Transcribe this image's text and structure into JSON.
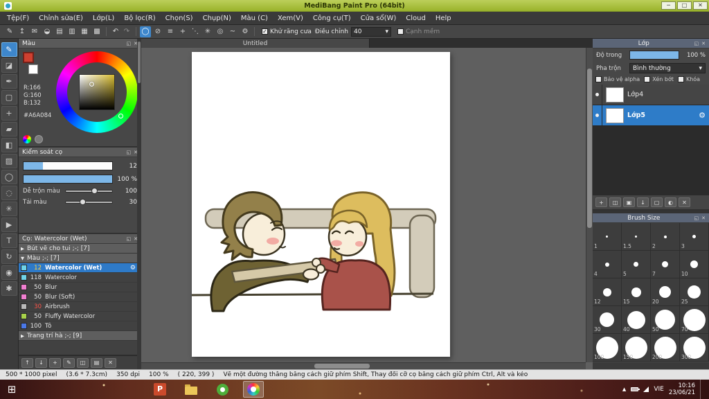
{
  "window": {
    "title": "MediBang Paint Pro (64bit)",
    "controls": [
      "─",
      "□",
      "✕"
    ]
  },
  "ui": {
    "detach_icon": "◱",
    "close_icon": "✕",
    "arrow_down": "▾",
    "gear": "⚙",
    "check": "✓"
  },
  "menubar": {
    "items": [
      "Tệp(F)",
      "Chỉnh sửa(E)",
      "Lớp(L)",
      "Bộ lọc(R)",
      "Chọn(S)",
      "Chụp(N)",
      "Màu (C)",
      "Xem(V)",
      "Công cụ(T)",
      "Cửa sổ(W)",
      "Cloud",
      "Help"
    ]
  },
  "toolbar": {
    "file_icons": [
      {
        "name": "brush-edit-icon",
        "glyph": "✎"
      },
      {
        "name": "upload-icon",
        "glyph": "↥"
      },
      {
        "name": "comment-icon",
        "glyph": "✉"
      },
      {
        "name": "palette-icon",
        "glyph": "◒"
      },
      {
        "name": "document-icon",
        "glyph": "▤"
      },
      {
        "name": "panel-icon",
        "glyph": "▥"
      },
      {
        "name": "pixel-grid-icon",
        "glyph": "▦"
      },
      {
        "name": "grid-icon",
        "glyph": "▩"
      }
    ],
    "undo_icon": "↶",
    "redo_icon": "↷",
    "snap_icons": [
      {
        "name": "brush-cursor-icon",
        "glyph": "◯",
        "selected": true
      },
      {
        "name": "snap-off-icon",
        "glyph": "⊘"
      },
      {
        "name": "snap-parallel-icon",
        "glyph": "≡"
      },
      {
        "name": "snap-cross-icon",
        "glyph": "+"
      },
      {
        "name": "snap-vanishing-icon",
        "glyph": "⋱"
      },
      {
        "name": "snap-radial-icon",
        "glyph": "✳"
      },
      {
        "name": "snap-ellipse-icon",
        "glyph": "◎"
      },
      {
        "name": "snap-curve-icon",
        "glyph": "~"
      },
      {
        "name": "snap-settings-icon",
        "glyph": "⚙"
      }
    ],
    "antialias_label": "Khử răng cưa",
    "adjust_label": "Điều chỉnh",
    "adjust_value": "40",
    "soft_edge_label": "Cạnh mềm"
  },
  "tools": {
    "items": [
      {
        "name": "brush-tool",
        "glyph": "✎",
        "selected": true
      },
      {
        "name": "eraser-tool",
        "glyph": "◪"
      },
      {
        "name": "pen-tool",
        "glyph": "✒"
      },
      {
        "name": "select-tool",
        "glyph": "▢"
      },
      {
        "name": "move-tool",
        "glyph": "+"
      },
      {
        "name": "fill-tool",
        "glyph": "▰"
      },
      {
        "name": "bucket-tool",
        "glyph": "◧"
      },
      {
        "name": "gradient-tool",
        "glyph": "▨"
      },
      {
        "name": "ellipse-select-tool",
        "glyph": "◯"
      },
      {
        "name": "lasso-tool",
        "glyph": "◌"
      },
      {
        "name": "magic-wand-tool",
        "glyph": "✳"
      },
      {
        "name": "operation-tool",
        "glyph": "▶"
      },
      {
        "name": "text-tool",
        "glyph": "T"
      },
      {
        "name": "rotate-tool",
        "glyph": "↻"
      },
      {
        "name": "eyedropper-tool",
        "glyph": "◉"
      },
      {
        "name": "hand-tool",
        "glyph": "✱"
      }
    ]
  },
  "color_panel": {
    "title": "Màu",
    "rgb_r": "R:166",
    "rgb_g": "G:160",
    "rgb_b": "B:132",
    "hex": "#A6A084",
    "foreground_color": "#cf4030",
    "background_color": "#ffffff",
    "square_hue": "#d8bc30"
  },
  "brush_control": {
    "title": "Kiểm soát cọ",
    "size_value": "12",
    "opacity_value": "100 %",
    "mix_label": "Dễ trộn màu",
    "mix_value": "100",
    "load_label": "Tải màu",
    "load_value": "30"
  },
  "brush_panel": {
    "title": "Cọ: Watercolor (Wet)",
    "groups": [
      {
        "label": "Bút vẽ cho tui ;-; [7]",
        "arrow": "▶"
      },
      {
        "label": "Màu ;-; [7]",
        "arrow": "▼"
      }
    ],
    "brushes": [
      {
        "size": "12",
        "name": "Watercolor (Wet)",
        "swatch": "#6fd3e8",
        "selected": true,
        "size_color": "#ffcf3f"
      },
      {
        "size": "118",
        "name": "Watercolor",
        "swatch": "#6fd3e8"
      },
      {
        "size": "50",
        "name": "Blur",
        "swatch": "#f07fd0"
      },
      {
        "size": "50",
        "name": "Blur (Soft)",
        "swatch": "#f07fd0"
      },
      {
        "size": "30",
        "name": "Airbrush",
        "swatch": "#b9b9b9",
        "size_color": "#ff5348"
      },
      {
        "size": "50",
        "name": "Fluffy Watercolor",
        "swatch": "#a8d24a"
      },
      {
        "size": "100",
        "name": "Tô",
        "swatch": "#4a78e8"
      }
    ],
    "footer_group": {
      "label": "Trang trí hà ;-; [9]",
      "arrow": "▶"
    },
    "footer_buttons": [
      {
        "name": "move-up-brush-button",
        "glyph": "↑"
      },
      {
        "name": "move-down-brush-button",
        "glyph": "↓"
      },
      {
        "name": "add-brush-button",
        "glyph": "+"
      },
      {
        "name": "edit-brush-button",
        "glyph": "✎"
      },
      {
        "name": "brush-folder-button",
        "glyph": "◫"
      },
      {
        "name": "brush-list-button",
        "glyph": "▤"
      },
      {
        "name": "delete-brush-button",
        "glyph": "✕"
      }
    ]
  },
  "canvas": {
    "tab_title": "Untitled"
  },
  "layers_panel": {
    "title": "Lớp",
    "opacity_label": "Độ trong",
    "opacity_value": "100 %",
    "blend_label": "Pha trộn",
    "blend_value": "Bình thường",
    "checkboxes": [
      "Bảo vệ alpha",
      "Xén bớt",
      "Khóa"
    ],
    "layers": [
      {
        "name": "Lớp4",
        "selected": false
      },
      {
        "name": "Lớp5",
        "selected": true
      }
    ],
    "buttons": [
      {
        "name": "add-layer-button",
        "glyph": "+"
      },
      {
        "name": "layer-folder-button",
        "glyph": "◫"
      },
      {
        "name": "duplicate-layer-button",
        "glyph": "▣"
      },
      {
        "name": "merge-layer-button",
        "glyph": "↓"
      },
      {
        "name": "clear-layer-button",
        "glyph": "▢"
      },
      {
        "name": "layer-mask-button",
        "glyph": "◐"
      },
      {
        "name": "delete-layer-button",
        "glyph": "✕"
      }
    ]
  },
  "brush_size_panel": {
    "title": "Brush Size",
    "sizes": [
      "1",
      "1.5",
      "2",
      "3",
      "4",
      "5",
      "7",
      "10",
      "12",
      "15",
      "20",
      "25",
      "30",
      "40",
      "50",
      "70",
      "100",
      "150",
      "200",
      "300"
    ]
  },
  "statusbar": {
    "doc_size": "500 * 1000 pixel",
    "cm": "(3.6 * 7.3cm)",
    "dpi": "350 dpi",
    "zoom": "100 %",
    "coords": "( 220, 399 )",
    "hint": "Vẽ một đường thẳng bằng cách giữ phím Shift, Thay đổi cỡ cọ bằng cách giữ phím Ctrl, Alt và kéo"
  },
  "taskbar": {
    "start_glyph": "⊞",
    "powerpoint_letter": "P",
    "language": "VIE",
    "time": "10:16",
    "date": "23/06/21"
  }
}
